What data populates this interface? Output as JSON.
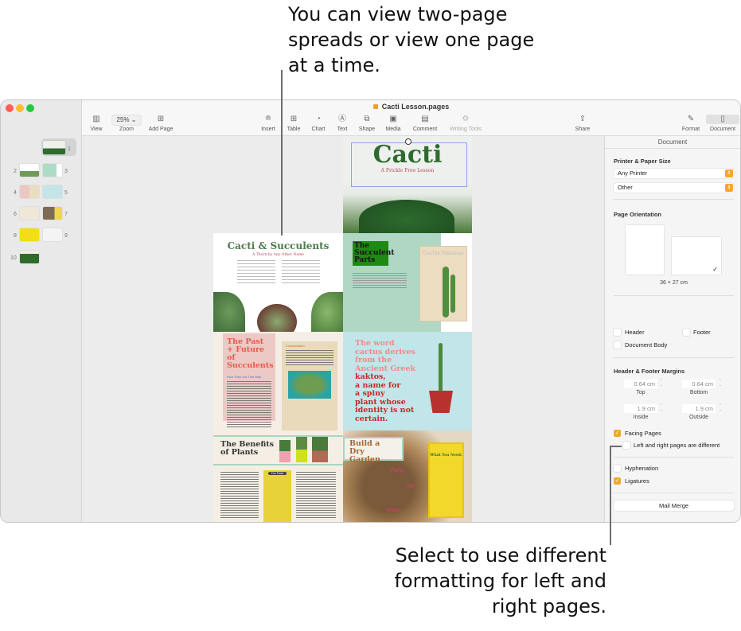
{
  "callouts": {
    "top": "You can view two-page spreads or view one page at a time.",
    "bottom": "Select to use different formatting for left and right pages."
  },
  "window": {
    "title": "Cacti Lesson.pages",
    "title_icon": "pages-document-icon"
  },
  "toolbar": {
    "view": {
      "label": "View",
      "icon": "sidebar-icon"
    },
    "zoom": {
      "label": "Zoom",
      "value": "25%"
    },
    "add_page": {
      "label": "Add Page",
      "icon": "plus-square-icon"
    },
    "insert": {
      "label": "Insert",
      "icon": "insert-icon"
    },
    "table": {
      "label": "Table",
      "icon": "table-icon"
    },
    "chart": {
      "label": "Chart",
      "icon": "chart-icon"
    },
    "text": {
      "label": "Text",
      "icon": "text-box-icon"
    },
    "shape": {
      "label": "Shape",
      "icon": "shape-icon"
    },
    "media": {
      "label": "Media",
      "icon": "media-icon"
    },
    "comment": {
      "label": "Comment",
      "icon": "comment-icon"
    },
    "writing_tools": {
      "label": "Writing Tools",
      "icon": "writing-tools-icon"
    },
    "share": {
      "label": "Share",
      "icon": "share-icon"
    },
    "format": {
      "label": "Format",
      "icon": "paintbrush-icon"
    },
    "document": {
      "label": "Document",
      "icon": "document-icon"
    }
  },
  "thumbnails": [
    "1",
    "2",
    "3",
    "4",
    "5",
    "6",
    "7",
    "8",
    "9",
    "10"
  ],
  "pages": {
    "p1": {
      "title": "Cacti",
      "subtitle": "A Prickle Free Lesson"
    },
    "p2": {
      "title": "Cacti & Succulents",
      "subtitle": "A Thorn by Any Other Name"
    },
    "p3": {
      "title": "The Succulent Parts",
      "card_title": "Cactus Fabulous"
    },
    "p4": {
      "title": "The Past + Future of Succulents",
      "section": "How They Got This Way",
      "sidebar_label": "Conservation"
    },
    "p5": {
      "line1": "The word",
      "line2": "cactus derives",
      "line3": "from the",
      "line4": "Ancient Greek",
      "line5": "kaktos,",
      "line6": "a name for",
      "line7": "a spiny",
      "line8": "plant whose",
      "line9": "identity is not",
      "line10": "certain."
    },
    "p6": {
      "title": "The Benefits of Plants",
      "card_title": "Fun Facts"
    },
    "p7": {
      "title": "Build a Dry Garden",
      "card_title": "What You Need:",
      "label_plants": "Plants",
      "label_soil": "Soil",
      "label_bowls": "Bowls"
    }
  },
  "inspector": {
    "header": "Document",
    "printer_section": "Printer & Paper Size",
    "printer": "Any Printer",
    "paper": "Other",
    "orientation_section": "Page Orientation",
    "orientation_selected": "landscape",
    "paper_size": "36 × 27 cm",
    "header_label": "Header",
    "footer_label": "Footer",
    "header_checked": false,
    "footer_checked": false,
    "body_label": "Document Body",
    "body_checked": false,
    "margins_section": "Header & Footer Margins",
    "top_value": "0.64 cm",
    "top_label": "Top",
    "bottom_value": "0.64 cm",
    "bottom_label": "Bottom",
    "inside_value": "1.9 cm",
    "inside_label": "Inside",
    "outside_value": "1.9 cm",
    "outside_label": "Outside",
    "facing_label": "Facing Pages",
    "facing_checked": true,
    "lr_label": "Left and right pages are different",
    "lr_checked": false,
    "hyphenation_label": "Hyphenation",
    "hyphenation_checked": false,
    "ligatures_label": "Ligatures",
    "ligatures_checked": true,
    "mail_merge": "Mail Merge"
  },
  "colors": {
    "accent": "#f0a92c",
    "selection": "#6f8cf0"
  }
}
